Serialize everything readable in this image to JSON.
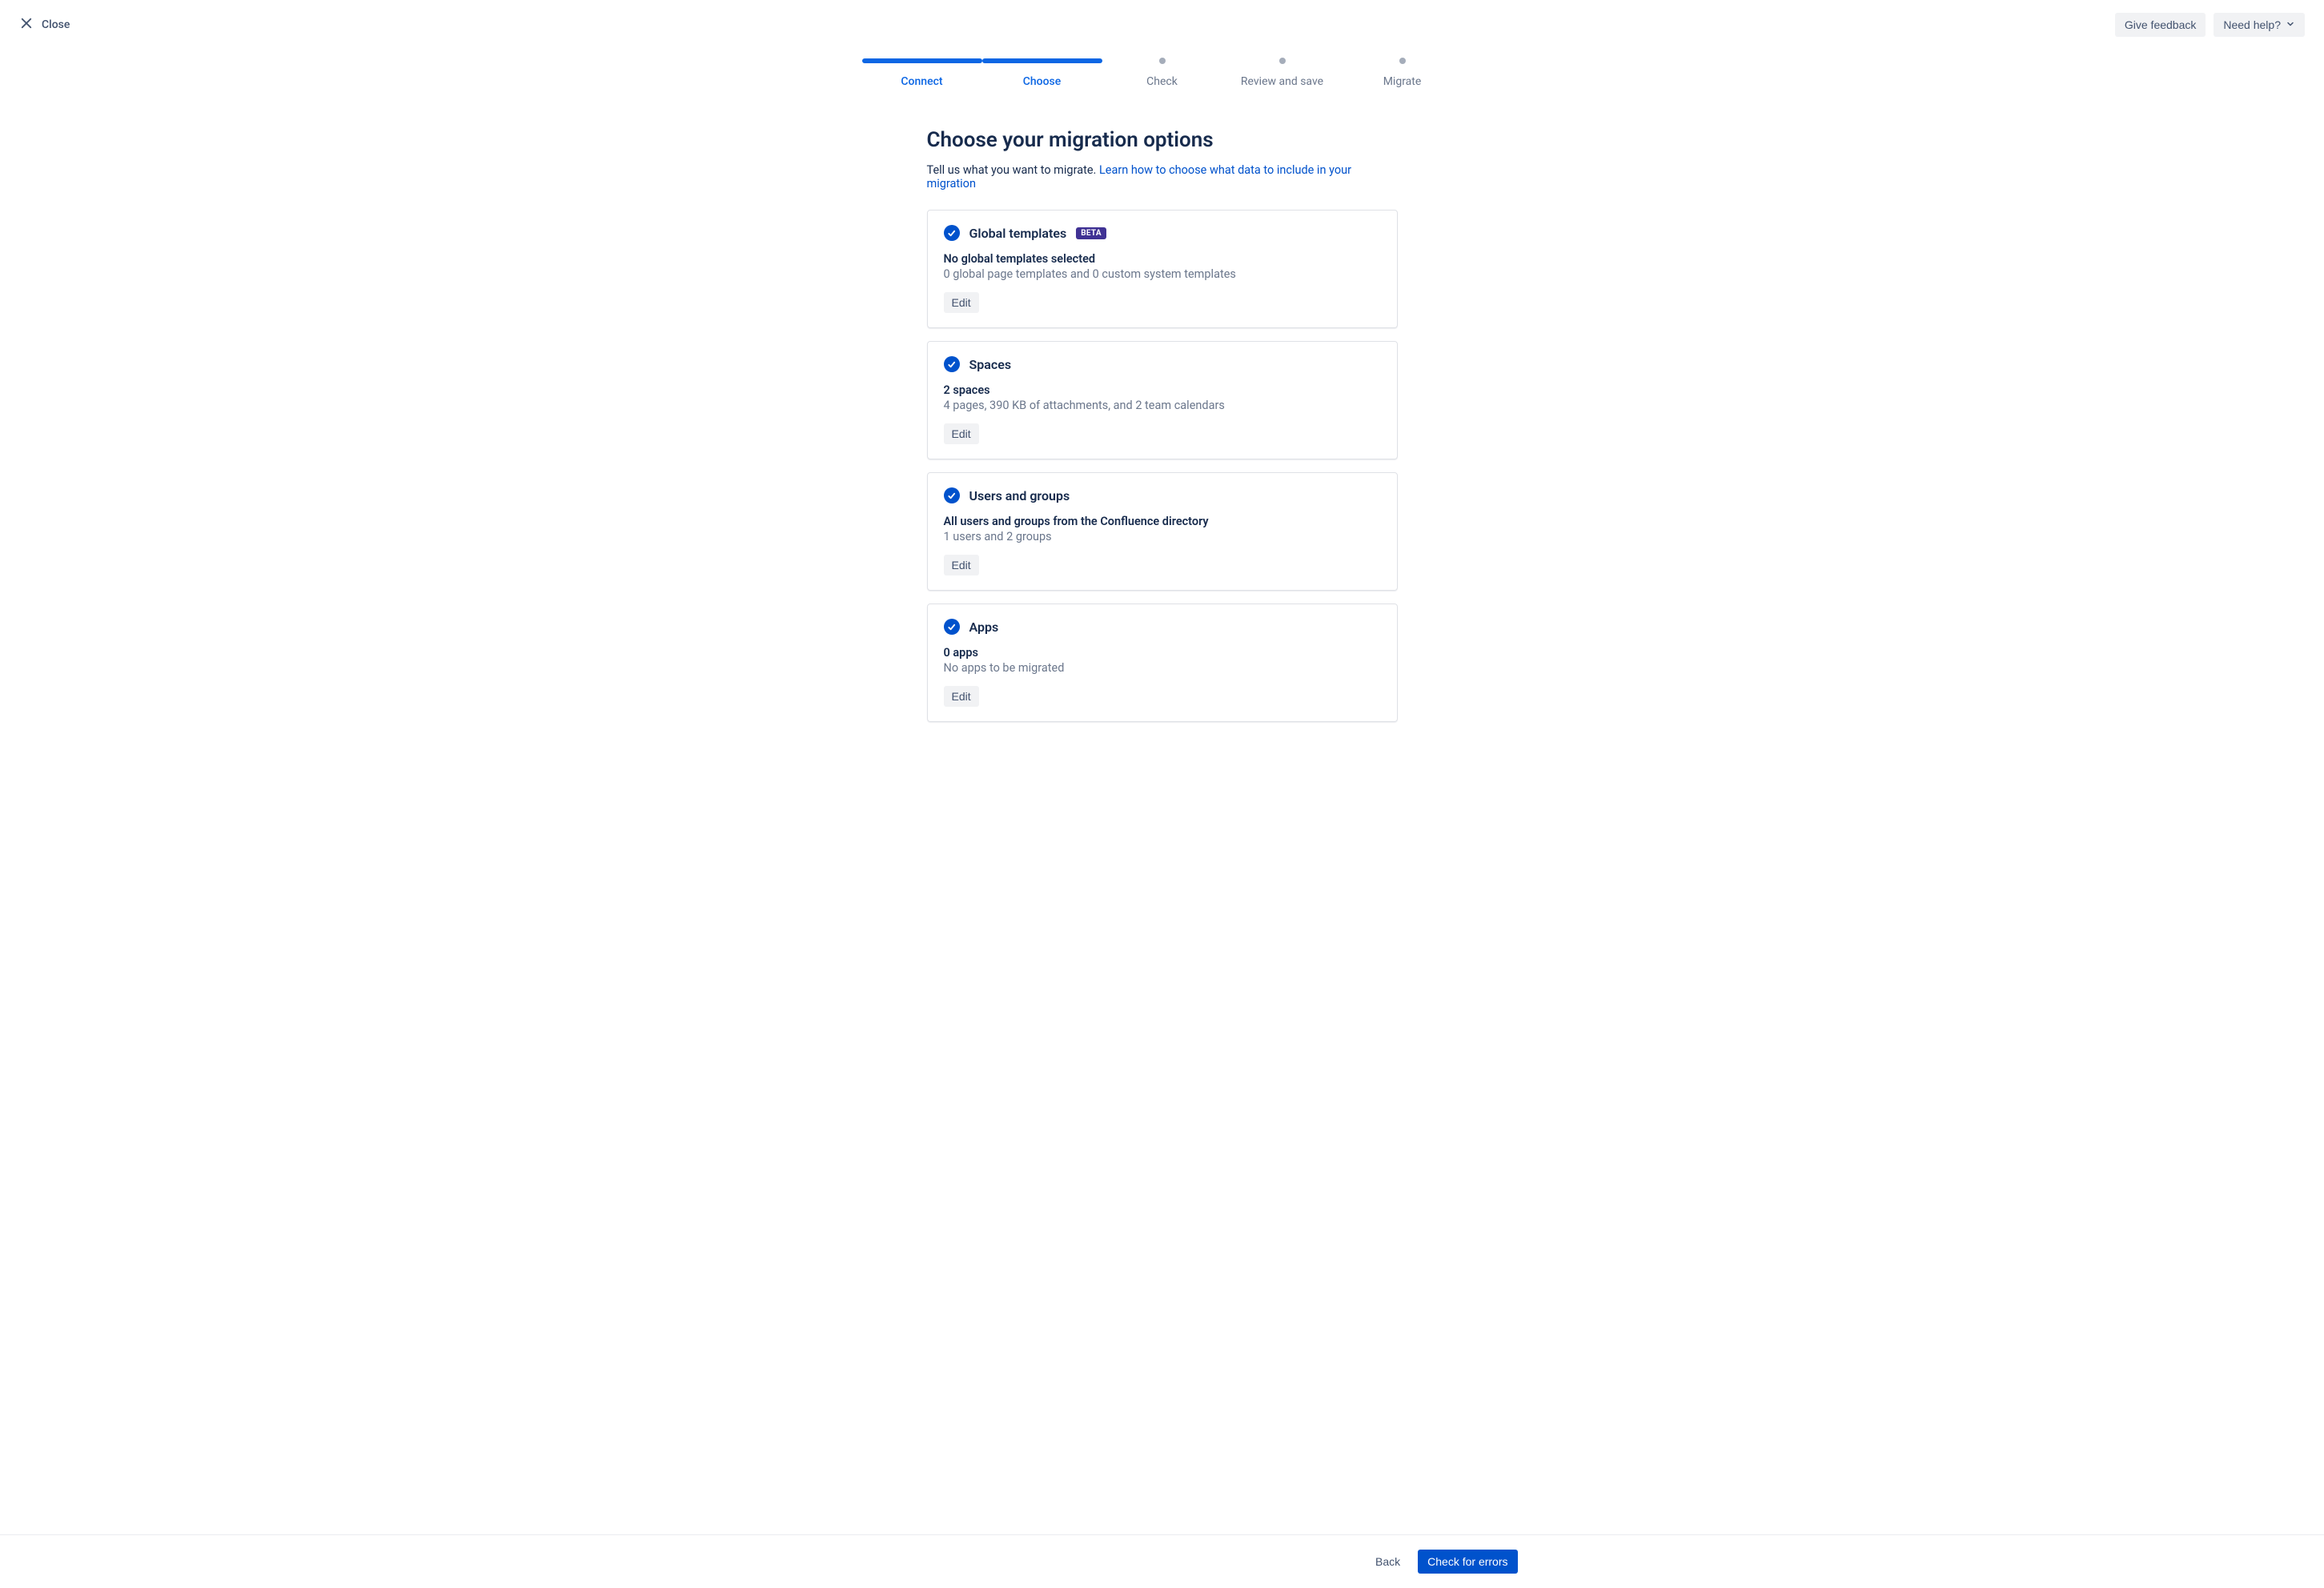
{
  "header": {
    "close_label": "Close",
    "feedback_label": "Give feedback",
    "help_label": "Need help?"
  },
  "stepper": {
    "steps": [
      {
        "label": "Connect",
        "state": "done"
      },
      {
        "label": "Choose",
        "state": "active"
      },
      {
        "label": "Check",
        "state": "todo"
      },
      {
        "label": "Review and save",
        "state": "todo"
      },
      {
        "label": "Migrate",
        "state": "todo"
      }
    ]
  },
  "page": {
    "title": "Choose your migration options",
    "intro_prefix": "Tell us what you want to migrate. ",
    "intro_link": "Learn how to choose what data to include in your migration"
  },
  "cards": {
    "global_templates": {
      "title": "Global templates",
      "badge": "BETA",
      "summary_bold": "No global templates selected",
      "summary_sub": "0 global page templates and 0 custom system templates",
      "edit_label": "Edit"
    },
    "spaces": {
      "title": "Spaces",
      "summary_bold": "2 spaces",
      "summary_sub": "4 pages, 390 KB of attachments, and 2 team calendars",
      "edit_label": "Edit"
    },
    "users_groups": {
      "title": "Users and groups",
      "summary_bold": "All users and groups from the Confluence directory",
      "summary_sub": "1 users and 2 groups",
      "edit_label": "Edit"
    },
    "apps": {
      "title": "Apps",
      "summary_bold": "0 apps",
      "summary_sub": "No apps to be migrated",
      "edit_label": "Edit"
    }
  },
  "footer": {
    "back_label": "Back",
    "primary_label": "Check for errors"
  }
}
